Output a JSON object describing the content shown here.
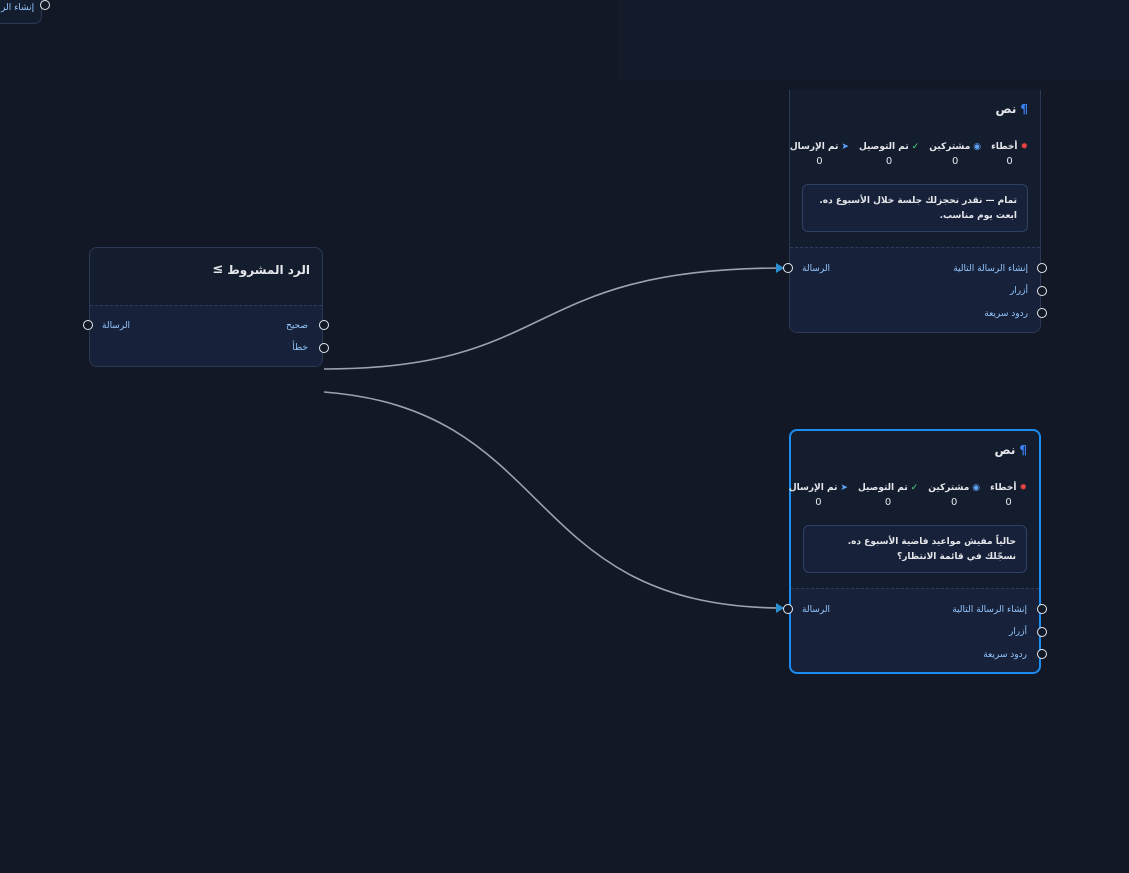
{
  "stub_node": {
    "label": "إنشاء الر"
  },
  "condition_node": {
    "title": "الرد المشروط",
    "input_label": "الرسالة",
    "true_label": "صحيح",
    "false_label": "خطأ"
  },
  "text_node_1": {
    "title": "نص",
    "stats": [
      {
        "label": "أخطاء",
        "value": "0",
        "icon": "bug-icon",
        "color": "#ef4444"
      },
      {
        "label": "مشتركين",
        "value": "0",
        "icon": "user-circle-icon",
        "color": "#60a5fa"
      },
      {
        "label": "تم التوصيل",
        "value": "0",
        "icon": "check-circle-icon",
        "color": "#4ade80"
      },
      {
        "label": "تم الإرسال",
        "value": "0",
        "icon": "send-icon",
        "color": "#60a5fa"
      }
    ],
    "message": "تمام — نقدر نحجزلك جلسة خلال الأسبوع ده. ابعت يوم مناسب.",
    "input_label": "الرسالة",
    "outputs": [
      "إنشاء الرسالة التالية",
      "أزرار",
      "ردود سريعة"
    ]
  },
  "text_node_2": {
    "title": "نص",
    "stats": [
      {
        "label": "أخطاء",
        "value": "0",
        "icon": "bug-icon",
        "color": "#ef4444"
      },
      {
        "label": "مشتركين",
        "value": "0",
        "icon": "user-circle-icon",
        "color": "#60a5fa"
      },
      {
        "label": "تم التوصيل",
        "value": "0",
        "icon": "check-circle-icon",
        "color": "#4ade80"
      },
      {
        "label": "تم الإرسال",
        "value": "0",
        "icon": "send-icon",
        "color": "#60a5fa"
      }
    ],
    "message": "حالياً مفيش مواعيد فاضية الأسبوع ده. نسجّلك في قائمة الانتظار؟",
    "input_label": "الرسالة",
    "outputs": [
      "إنشاء الرسالة التالية",
      "أزرار",
      "ردود سريعة"
    ]
  },
  "colors": {
    "canvas": "#121826",
    "node_bg": "#141d2e",
    "selected_border": "#1d8cf0",
    "port_label": "#93c5fd",
    "edge": "#9ca3af"
  }
}
